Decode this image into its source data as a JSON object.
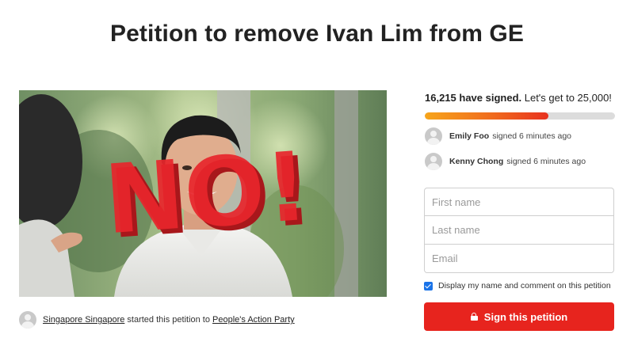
{
  "page": {
    "title": "Petition to remove Ivan Lim from GE"
  },
  "photo": {
    "overlay_text": "NO!"
  },
  "starter": {
    "name": "Singapore Singapore",
    "middle_text": " started this petition to ",
    "target": "People's Action Party"
  },
  "signatures": {
    "count": "16,215 have signed.",
    "goal_text": " Let's get to 25,000!",
    "progress_fraction": 0.6486,
    "recent": [
      {
        "name": "Emily Foo",
        "action": "signed 6 minutes ago"
      },
      {
        "name": "Kenny Chong",
        "action": "signed 6 minutes ago"
      }
    ]
  },
  "form": {
    "first_name_placeholder": "First name",
    "last_name_placeholder": "Last name",
    "email_placeholder": "Email",
    "consent_label": "Display my name and comment on this petition",
    "consent_checked": true,
    "submit_label": "Sign this petition"
  },
  "colors": {
    "button": "#e7241e",
    "progress_start": "#f7a51b",
    "progress_end": "#e8321f",
    "overlay_text": "#e8262c"
  }
}
